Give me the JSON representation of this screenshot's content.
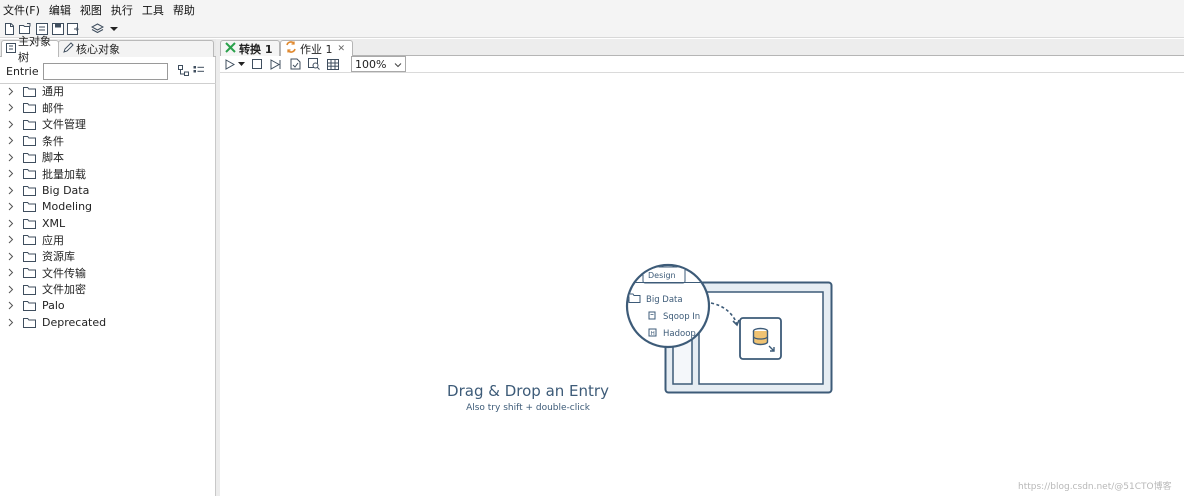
{
  "menu": [
    "文件(F)",
    "编辑",
    "视图",
    "执行",
    "工具",
    "帮助"
  ],
  "toolbar_icons": [
    "new-file-icon",
    "open-icon",
    "explore-repo-icon",
    "save-icon",
    "save-as-icon",
    "layers-icon",
    "dropdown-arrow-icon"
  ],
  "left_panel": {
    "tabs": [
      {
        "label": "主对象树",
        "icon": "tree-icon"
      },
      {
        "label": "核心对象",
        "icon": "pencil-icon"
      }
    ],
    "entries_label": "Entries",
    "entries_value": "",
    "tree": [
      {
        "label": "通用"
      },
      {
        "label": "邮件"
      },
      {
        "label": "文件管理"
      },
      {
        "label": "条件"
      },
      {
        "label": "脚本"
      },
      {
        "label": "批量加载"
      },
      {
        "label": "Big Data"
      },
      {
        "label": "Modeling"
      },
      {
        "label": "XML"
      },
      {
        "label": "应用"
      },
      {
        "label": "资源库"
      },
      {
        "label": "文件传输"
      },
      {
        "label": "文件加密"
      },
      {
        "label": "Palo"
      },
      {
        "label": "Deprecated"
      }
    ]
  },
  "editor": {
    "tabs": [
      {
        "label": "转换 1",
        "icon": "transform-icon"
      },
      {
        "label": "作业 1",
        "icon": "job-icon",
        "closable": true
      }
    ],
    "zoom": "100%",
    "canvas": {
      "illustration": {
        "tab_label": "Design",
        "folder_label": "Big Data",
        "item1": "Sqoop In",
        "item2": "Hadoop"
      },
      "title": "Drag & Drop an Entry",
      "subtitle": "Also try shift + double-click"
    }
  },
  "watermark": "https://blog.csdn.net/@51CTO博客",
  "colors": {
    "accent": "#3d5b78",
    "folder": "#3f4e5e",
    "job_icon": "#e0892f",
    "transform_icon": "#2aa14b"
  }
}
